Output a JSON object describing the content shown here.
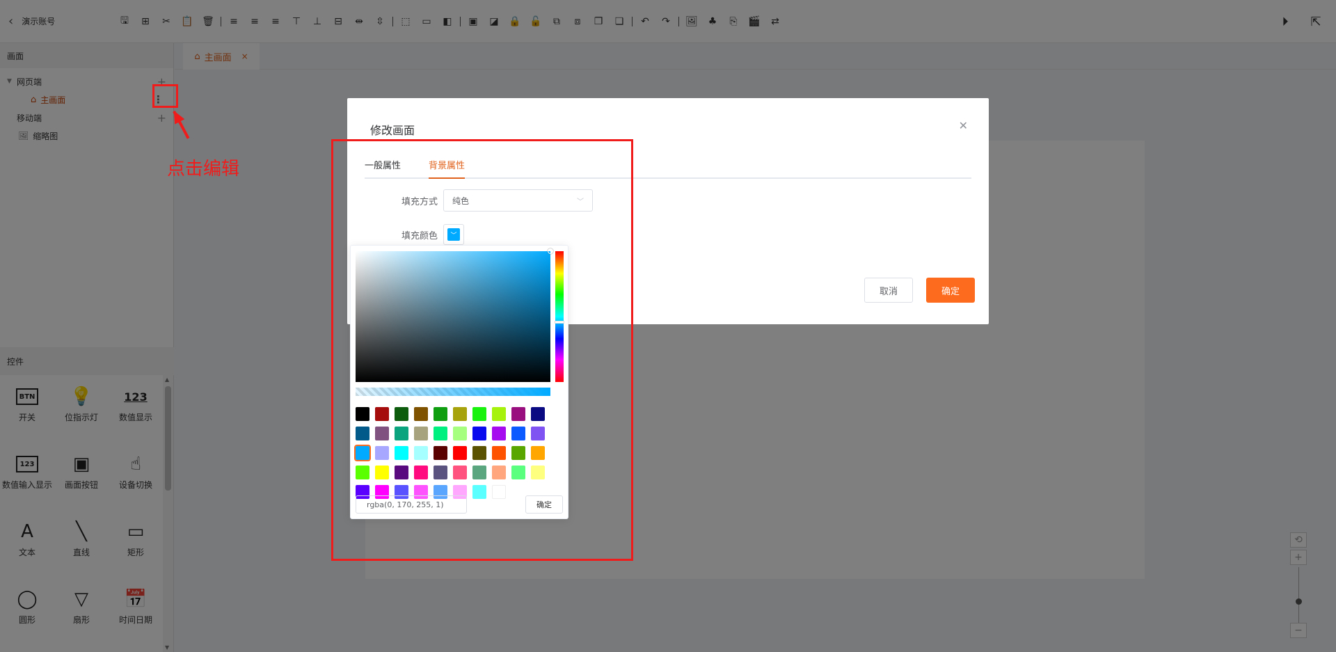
{
  "header": {
    "account_name": "演示账号"
  },
  "toolbar": {
    "icons": [
      "save-icon",
      "add-icon",
      "cut-icon",
      "paste-icon",
      "delete-icon",
      "align-left-icon",
      "align-center-icon",
      "align-right-icon",
      "align-top-icon",
      "align-bottom-icon",
      "align-middle-icon",
      "distribute-h-icon",
      "distribute-v-icon",
      "group-icon",
      "ungroup-icon",
      "bring-forward-icon",
      "image-icon",
      "send-backward-icon",
      "lock-icon",
      "unlock-icon",
      "layer-up-icon",
      "layer-down-icon",
      "bring-front-icon",
      "send-back-icon",
      "undo-icon",
      "redo-icon",
      "gallery-icon",
      "components-icon",
      "copy-style-icon",
      "video-icon",
      "swap-icon"
    ]
  },
  "left_panel": {
    "screens_title": "画面",
    "web_section": "网页端",
    "main_screen": "主画面",
    "mobile_section": "移动端",
    "thumbnail": "缩略图",
    "controls_title": "控件",
    "controls": [
      {
        "label": "开关",
        "icon": "btn-icon",
        "glyph": "BTN"
      },
      {
        "label": "位指示灯",
        "icon": "bulb-icon",
        "glyph": "💡"
      },
      {
        "label": "数值显示",
        "icon": "number-display-icon",
        "glyph": "123"
      },
      {
        "label": "数值输入显示",
        "icon": "number-input-icon",
        "glyph": "123"
      },
      {
        "label": "画面按钮",
        "icon": "screen-button-icon",
        "glyph": "▣"
      },
      {
        "label": "设备切换",
        "icon": "device-switch-icon",
        "glyph": "☝"
      },
      {
        "label": "文本",
        "icon": "text-icon",
        "glyph": "A"
      },
      {
        "label": "直线",
        "icon": "line-icon",
        "glyph": "╲"
      },
      {
        "label": "矩形",
        "icon": "rectangle-icon",
        "glyph": "▭"
      },
      {
        "label": "圆形",
        "icon": "circle-icon",
        "glyph": "◯"
      },
      {
        "label": "扇形",
        "icon": "sector-icon",
        "glyph": "▽"
      },
      {
        "label": "时间日期",
        "icon": "datetime-icon",
        "glyph": "📅"
      }
    ]
  },
  "tabs": [
    {
      "label": "主画面"
    }
  ],
  "annotation": {
    "text": "点击编辑"
  },
  "dialog": {
    "title": "修改画面",
    "tabs": [
      {
        "label": "一般属性"
      },
      {
        "label": "背景属性"
      }
    ],
    "fill_mode_label": "填充方式",
    "fill_mode_value": "纯色",
    "fill_color_label": "填充颜色",
    "cancel_label": "取消",
    "confirm_label": "确定"
  },
  "color_picker": {
    "current": "#00aaff",
    "rgba_value": "rgba(0, 170, 255, 1)",
    "confirm_label": "确定",
    "swatches": [
      "#000000",
      "#a50d0d",
      "#0d5c0d",
      "#7f5200",
      "#0f9e0f",
      "#a7a30c",
      "#18f20c",
      "#a6f20d",
      "#9a0f7f",
      "#0a0a82",
      "#015a8a",
      "#7f527f",
      "#0aa57f",
      "#a7a37f",
      "#00f07f",
      "#a7ff7f",
      "#0a0aef",
      "#a60aef",
      "#0a5aff",
      "#7f52f2",
      "#00aaff",
      "#a7a7ff",
      "#00ffff",
      "#a6ffff",
      "#590000",
      "#ff0000",
      "#5a5200",
      "#ff5200",
      "#5aa600",
      "#ffa600",
      "#5aff00",
      "#ffff00",
      "#590a7f",
      "#ff0a7f",
      "#5a527f",
      "#ff527f",
      "#5aa67f",
      "#ffa67f",
      "#5aff7f",
      "#ffff7f",
      "#5a00ff",
      "#ff00ff",
      "#5a52ff",
      "#ff52ff",
      "#5aa6ff",
      "#ffa6ff",
      "#5affff",
      "#ffffff"
    ]
  }
}
